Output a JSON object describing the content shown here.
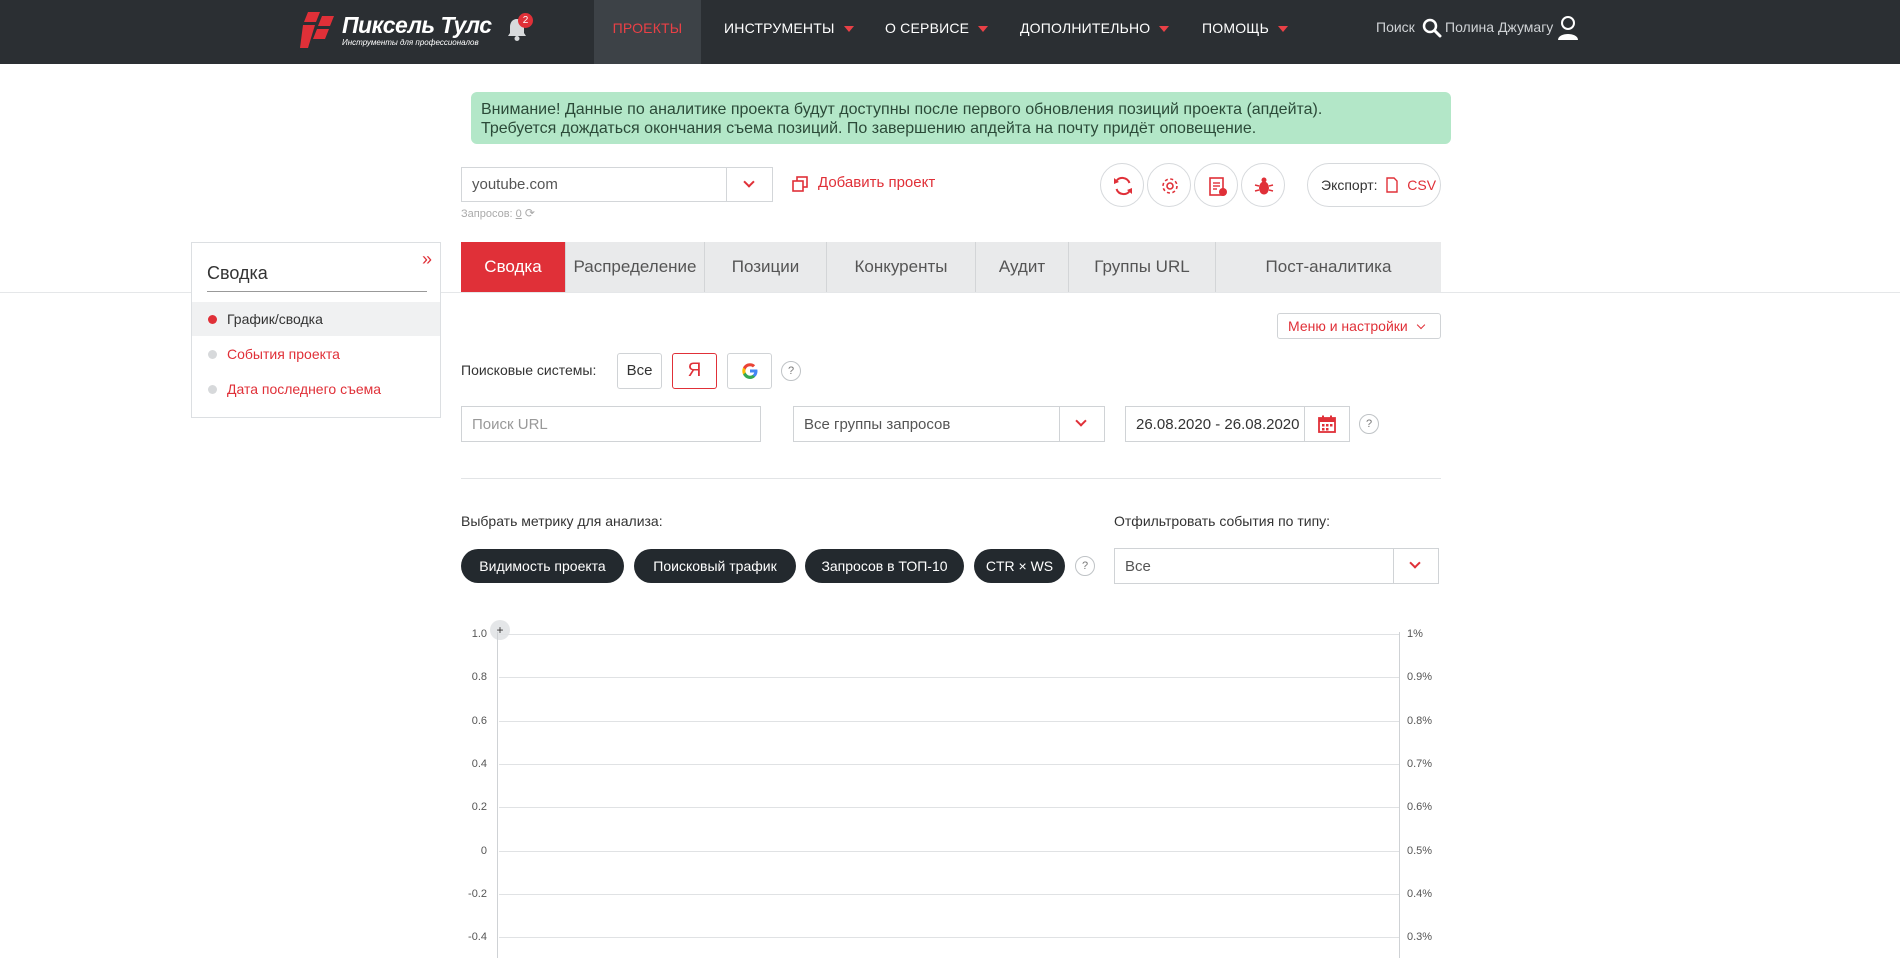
{
  "header": {
    "logo_title": "Пиксель Тулс",
    "logo_subtitle": "Инструменты для профессионалов",
    "notifications_count": "2",
    "nav": [
      {
        "label": "ПРОЕКТЫ",
        "active": true
      },
      {
        "label": "ИНСТРУМЕНТЫ"
      },
      {
        "label": "О СЕРВИСЕ"
      },
      {
        "label": "ДОПОЛНИТЕЛЬНО"
      },
      {
        "label": "ПОМОЩЬ"
      }
    ],
    "search_label": "Поиск",
    "user_name": "Полина Джумагу"
  },
  "alert": {
    "text_line1": "Внимание! Данные по аналитике проекта будут доступны после первого обновления позиций проекта (апдейта).",
    "text_line2": "Требуется дождаться окончания съема позиций. По завершению апдейта на почту придёт оповещение."
  },
  "project": {
    "selected": "youtube.com",
    "add_label": "Добавить проект",
    "requests_label": "Запросов:",
    "requests_count": "0"
  },
  "export": {
    "label": "Экспорт:",
    "format": "CSV"
  },
  "sidebar": {
    "title": "Сводка",
    "items": [
      {
        "label": "График/сводка",
        "active": true
      },
      {
        "label": "События проекта"
      },
      {
        "label": "Дата последнего съема"
      }
    ]
  },
  "tabs": [
    {
      "label": "Сводка",
      "active": true
    },
    {
      "label": "Распределение"
    },
    {
      "label": "Позиции"
    },
    {
      "label": "Конкуренты"
    },
    {
      "label": "Аудит"
    },
    {
      "label": "Группы URL"
    },
    {
      "label": "Пост-аналитика"
    }
  ],
  "filters": {
    "menu_settings": "Меню и настройки",
    "search_systems_label": "Поисковые системы:",
    "se_all": "Все",
    "se_yandex": "Я",
    "url_placeholder": "Поиск URL",
    "groups_value": "Все группы запросов",
    "date_range": "26.08.2020 - 26.08.2020",
    "help": "?"
  },
  "metrics": {
    "label": "Выбрать метрику для анализа:",
    "options": [
      "Видимость проекта",
      "Поисковый трафик",
      "Запросов в ТОП-10",
      "CTR × WS"
    ],
    "events_label": "Отфильтровать события по типу:",
    "events_value": "Все"
  },
  "chart_data": {
    "type": "line",
    "series": [],
    "y_left_ticks": [
      "1.0",
      "0.8",
      "0.6",
      "0.4",
      "0.2",
      "0",
      "-0.2",
      "-0.4"
    ],
    "y_right_ticks": [
      "1%",
      "0.9%",
      "0.8%",
      "0.7%",
      "0.6%",
      "0.5%",
      "0.4%",
      "0.3%"
    ],
    "zoom_label": "+"
  },
  "colors": {
    "accent": "#e03038",
    "topbar": "#2b2f33",
    "alert_bg": "#b3e7c8",
    "pill_bg": "#23292e"
  }
}
